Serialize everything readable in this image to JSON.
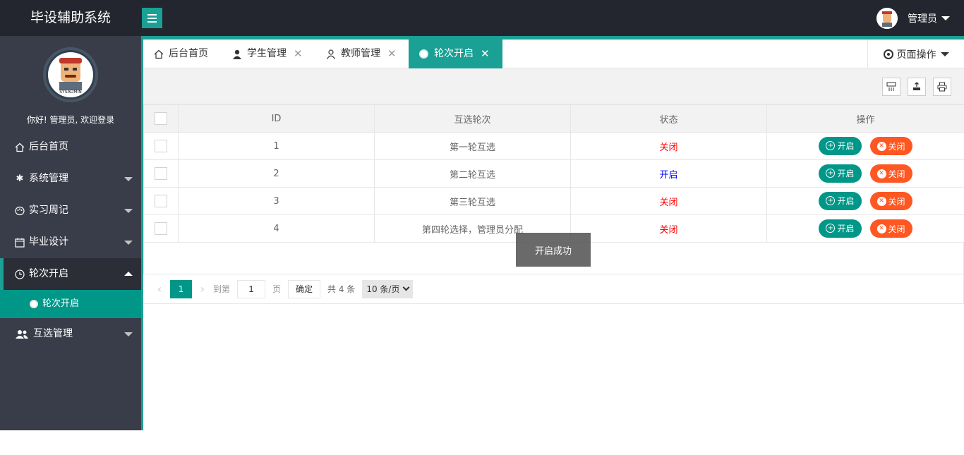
{
  "header": {
    "brand": "毕设辅助系统",
    "user_name": "管理员"
  },
  "sidebar": {
    "greeting": "你好! 管理员, 欢迎登录",
    "avatar_text": "SYSADMIN",
    "items": [
      {
        "label": "后台首页",
        "icon": "home-icon"
      },
      {
        "label": "系统管理",
        "icon": "gear-icon"
      },
      {
        "label": "实习周记",
        "icon": "palette-icon"
      },
      {
        "label": "毕业设计",
        "icon": "calendar-icon"
      },
      {
        "label": "轮次开启",
        "icon": "clock-icon"
      },
      {
        "label": "互选管理",
        "icon": "users-icon"
      }
    ],
    "sub_item": "轮次开启"
  },
  "tabs": [
    {
      "label": "后台首页",
      "icon": "home-icon"
    },
    {
      "label": "学生管理",
      "icon": "user-icon"
    },
    {
      "label": "教师管理",
      "icon": "user-outline-icon"
    },
    {
      "label": "轮次开启",
      "icon": "circle-icon"
    }
  ],
  "page_ops": "页面操作",
  "table": {
    "headers": [
      "ID",
      "互选轮次",
      "状态",
      "操作"
    ],
    "rows": [
      {
        "id": "1",
        "round": "第一轮互选",
        "status": "关闭"
      },
      {
        "id": "2",
        "round": "第二轮互选",
        "status": "开启"
      },
      {
        "id": "3",
        "round": "第三轮互选",
        "status": "关闭"
      },
      {
        "id": "4",
        "round": "第四轮选择，管理员分配",
        "status": "关闭"
      }
    ],
    "btn_open": "开启",
    "btn_close": "关闭"
  },
  "pager": {
    "current": "1",
    "goto_label": "到第",
    "goto_value": "1",
    "page_label": "页",
    "confirm": "确定",
    "total": "共 4 条",
    "page_size": "10 条/页"
  },
  "toast": "开启成功",
  "colors": {
    "accent": "#1aa094",
    "open_button": "#009688",
    "close_button": "#ff5722",
    "status_closed": "#ff0000",
    "status_open": "#0000ff"
  }
}
